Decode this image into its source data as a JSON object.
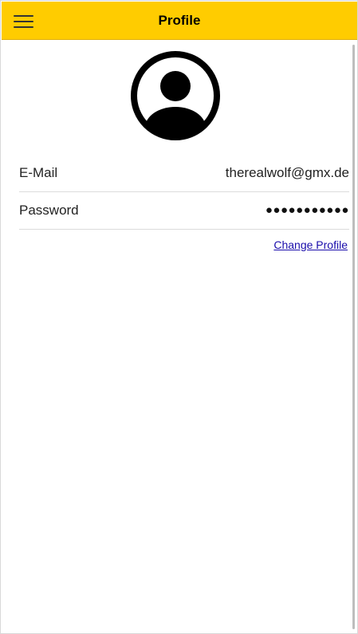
{
  "header": {
    "title": "Profile",
    "menu_icon": "hamburger-menu-icon",
    "background_color": "#ffcc00"
  },
  "profile": {
    "avatar_icon": "user-avatar-icon",
    "fields": [
      {
        "label": "E-Mail",
        "value": "therealwolf@gmx.de"
      },
      {
        "label": "Password",
        "value": "●●●●●●●●●●●"
      }
    ],
    "change_link": "Change Profile",
    "link_color": "#1a0dab"
  }
}
